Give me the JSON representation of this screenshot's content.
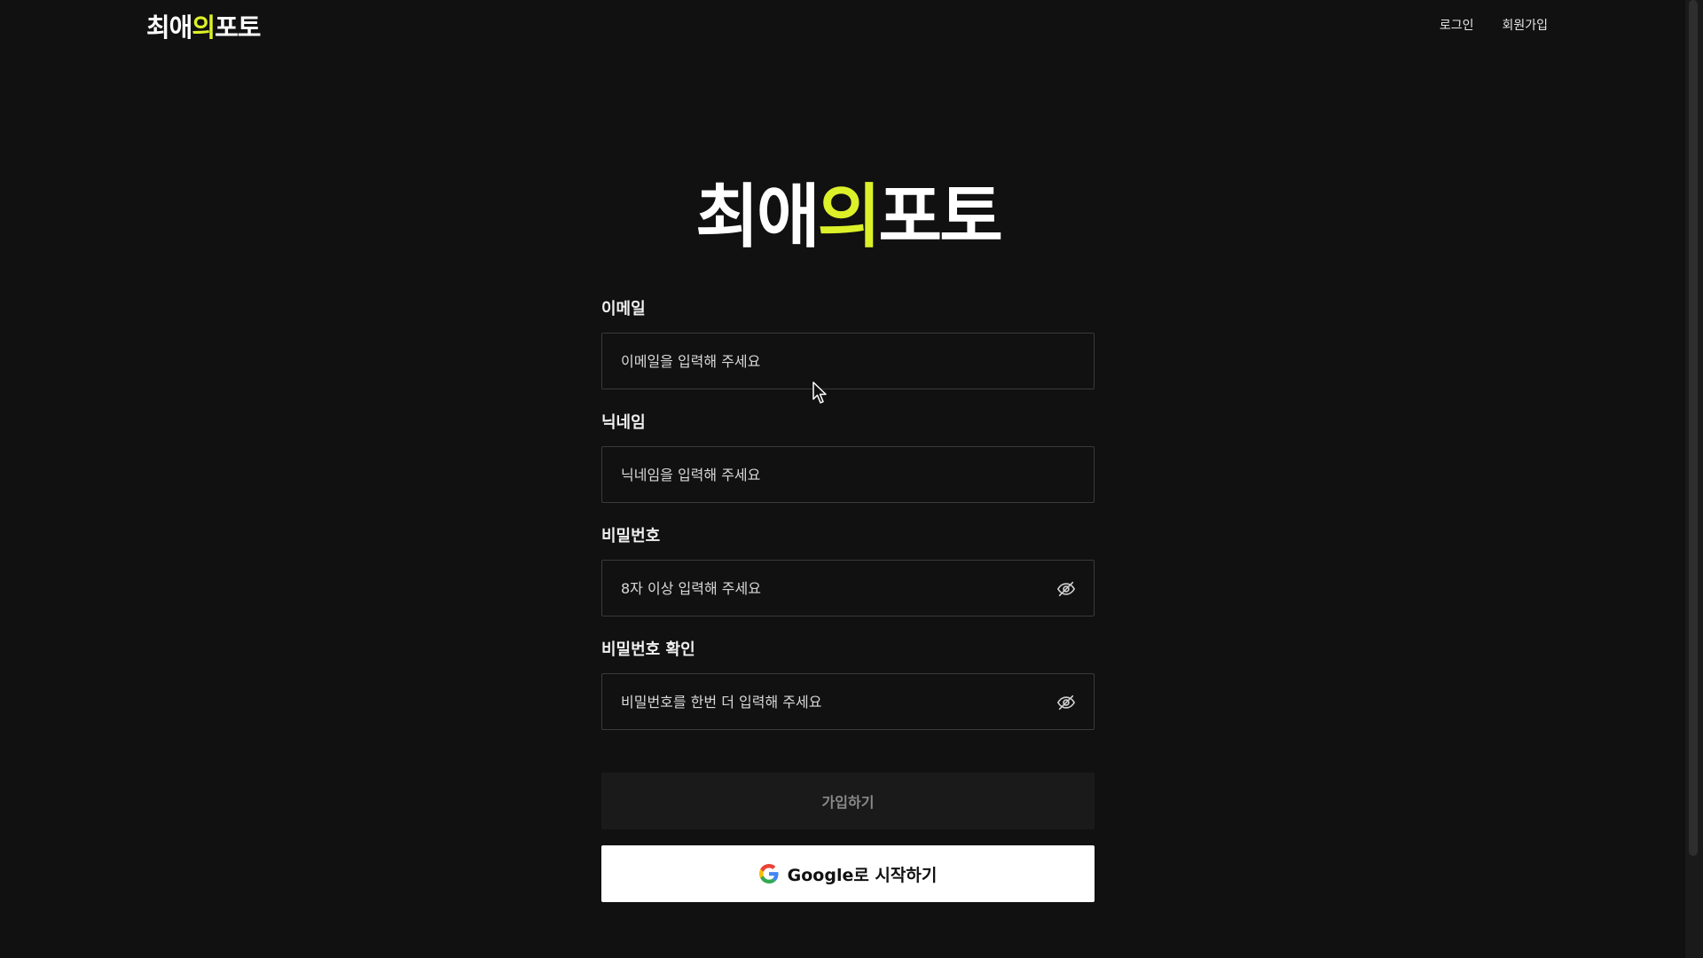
{
  "header": {
    "logo": {
      "part1": "최애",
      "accent": "의",
      "part2": "포토"
    },
    "nav": {
      "login": "로그인",
      "signup": "회원가입"
    }
  },
  "main": {
    "logo": {
      "part1": "최애",
      "accent": "의",
      "part2": "포토"
    },
    "fields": {
      "email": {
        "label": "이메일",
        "placeholder": "이메일을 입력해 주세요",
        "value": ""
      },
      "nickname": {
        "label": "닉네임",
        "placeholder": "닉네임을 입력해 주세요",
        "value": ""
      },
      "password": {
        "label": "비밀번호",
        "placeholder": "8자 이상 입력해 주세요",
        "value": ""
      },
      "password_confirm": {
        "label": "비밀번호 확인",
        "placeholder": "비밀번호를 한번 더 입력해 주세요",
        "value": ""
      }
    },
    "submit_label": "가입하기",
    "google_label": "Google로 시작하기"
  },
  "colors": {
    "background": "#111111",
    "accent": "#dcf128",
    "input_border": "#3a3a3a",
    "disabled_button": "#1a1a1a",
    "google_button": "#ffffff"
  },
  "icons": {
    "password_toggle": "eye-off-icon",
    "google": "google-icon",
    "cursor": "mouse-pointer-icon"
  }
}
